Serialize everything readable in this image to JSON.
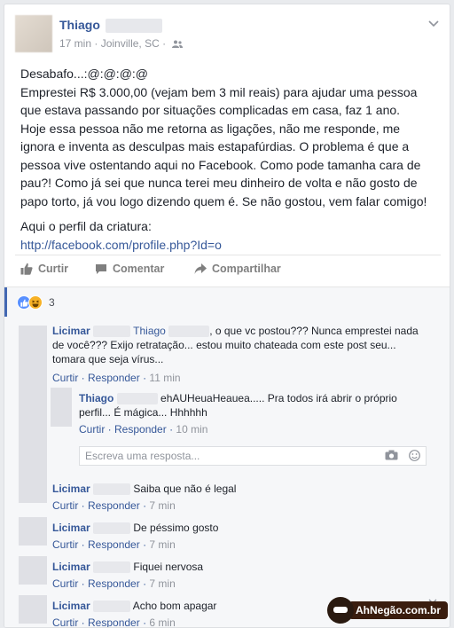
{
  "post": {
    "author": "Thiago",
    "time": "17 min",
    "location": "Joinville, SC",
    "separator": "·",
    "lines": [
      "Desabafo...:@:@:@:@",
      "Emprestei R$ 3.000,00 (vejam bem 3 mil reais) para ajudar uma pessoa",
      "que estava passando por situações complicadas em casa, faz 1 ano.",
      "Hoje essa pessoa não me retorna as ligações, não me responde, me",
      "ignora e inventa as desculpas mais estapafúrdias. O problema é que a",
      "pessoa vive ostentando aqui no Facebook. Como pode tamanha cara de",
      "pau?! Como já sei que nunca terei meu dinheiro de volta e não gosto de",
      "papo torto, já vou logo dizendo quem é. Se não gostou, vem falar comigo!"
    ],
    "profile_label": "Aqui o perfil da criatura:",
    "profile_link": "http://facebook.com/profile.php?Id=o"
  },
  "actions": {
    "like": "Curtir",
    "comment": "Comentar",
    "share": "Compartilhar"
  },
  "reactions": {
    "count": "3"
  },
  "comments": [
    {
      "name": "Licimar",
      "mention": "Thiago",
      "text1": ", o que vc postou??? Nunca emprestei nada",
      "text2": "de você??? Exijo retratação... estou muito chateada com este post seu...",
      "text3": "tomara que seja vírus...",
      "like": "Curtir",
      "reply": "Responder",
      "time": "11 min"
    },
    {
      "name": "Thiago",
      "text1": "ehAUHeuaHeauea..... Pra todos irá abrir o próprio",
      "text2": "perfil... É mágica... Hhhhhh",
      "like": "Curtir",
      "reply": "Responder",
      "time": "10 min"
    },
    {
      "name": "Licimar",
      "text1": "Saiba que não é legal",
      "like": "Curtir",
      "reply": "Responder",
      "time": "7 min"
    },
    {
      "name": "Licimar",
      "text1": "De péssimo gosto",
      "like": "Curtir",
      "reply": "Responder",
      "time": "7 min"
    },
    {
      "name": "Licimar",
      "text1": "Fiquei nervosa",
      "like": "Curtir",
      "reply": "Responder",
      "time": "7 min"
    },
    {
      "name": "Licimar",
      "text1": "Acho bom apagar",
      "like": "Curtir",
      "reply": "Responder",
      "time": "6 min"
    }
  ],
  "reply_placeholder": "Escreva uma resposta...",
  "watermark": "AhNegão.com.br",
  "colors": {
    "link": "#365899",
    "meta": "#90949c",
    "accent": "#4267b2"
  }
}
